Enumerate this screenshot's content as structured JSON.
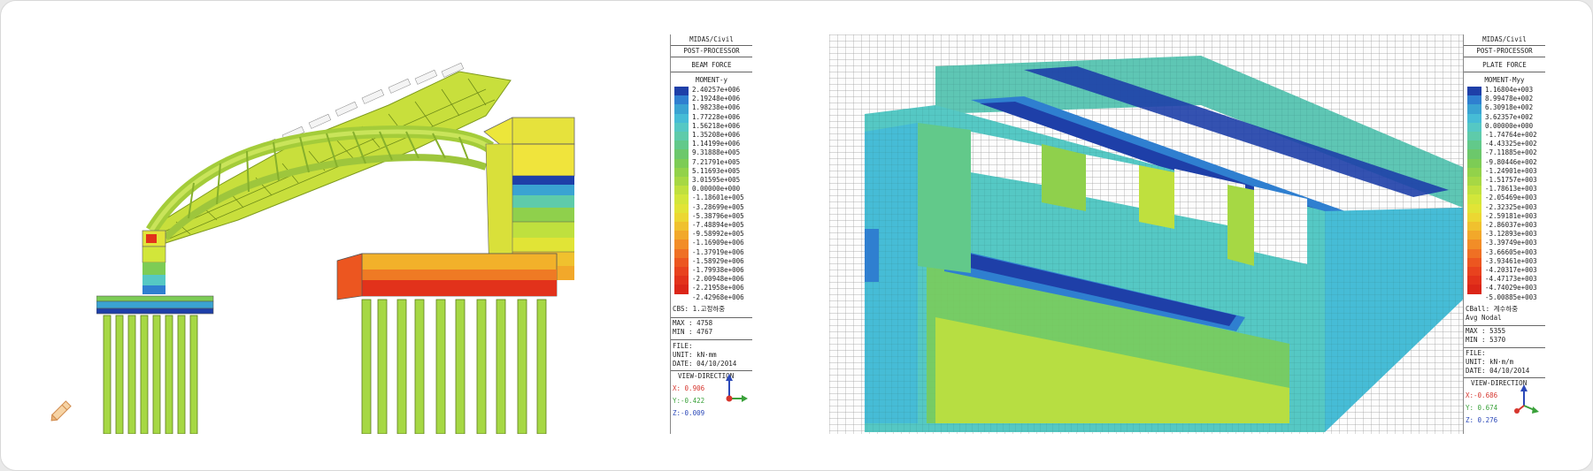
{
  "panels": [
    {
      "program": "MIDAS/Civil",
      "module": "POST-PROCESSOR",
      "force_type": "BEAM FORCE",
      "component": "MOMENT-y",
      "scale_values": [
        "2.40257e+006",
        "2.19248e+006",
        "1.98238e+006",
        "1.77228e+006",
        "1.56218e+006",
        "1.35208e+006",
        "1.14199e+006",
        "9.31888e+005",
        "7.21791e+005",
        "5.11693e+005",
        "3.01595e+005",
        "0.00000e+000",
        "-1.18601e+005",
        "-3.28699e+005",
        "-5.38796e+005",
        "-7.48894e+005",
        "-9.58992e+005",
        "-1.16909e+006",
        "-1.37919e+006",
        "-1.58929e+006",
        "-1.79938e+006",
        "-2.00948e+006",
        "-2.21958e+006",
        "-2.42968e+006"
      ],
      "load_case": "CBS: 1.고정하중",
      "max_label": "MAX : 4758",
      "min_label": "MIN : 4767",
      "file_label": "FILE:",
      "unit_label": "UNIT: kN·mm",
      "date_label": "DATE: 04/10/2014",
      "view_direction_label": "VIEW-DIRECTION",
      "view_x": "X: 0.906",
      "view_y": "Y:-0.422",
      "view_z": "Z:-0.009"
    },
    {
      "program": "MIDAS/Civil",
      "module": "POST-PROCESSOR",
      "force_type": "PLATE FORCE",
      "component": "MOMENT-Myy",
      "scale_values": [
        "1.16804e+003",
        "8.99478e+002",
        "6.30918e+002",
        "3.62357e+002",
        "0.00000e+000",
        "-1.74764e+002",
        "-4.43325e+002",
        "-7.11885e+002",
        "-9.80446e+002",
        "-1.24901e+003",
        "-1.51757e+003",
        "-1.78613e+003",
        "-2.05469e+003",
        "-2.32325e+003",
        "-2.59181e+003",
        "-2.86037e+003",
        "-3.12893e+003",
        "-3.39749e+003",
        "-3.66605e+003",
        "-3.93461e+003",
        "-4.20317e+003",
        "-4.47173e+003",
        "-4.74029e+003",
        "-5.00885e+003"
      ],
      "load_case": "CBall: 계수하중",
      "nodal_label": "Avg Nodal",
      "max_label": "MAX : 5355",
      "min_label": "MIN : 5370",
      "file_label": "FILE:",
      "unit_label": "UNIT: kN·m/m",
      "date_label": "DATE: 04/10/2014",
      "view_direction_label": "VIEW-DIRECTION",
      "view_x": "X:-0.686",
      "view_y": "Y: 0.674",
      "view_z": "Z: 0.276"
    }
  ],
  "colors": {
    "scale": [
      "#1e3fa8",
      "#2f7fd0",
      "#3aa3d2",
      "#46bcd6",
      "#55c8c4",
      "#5ecbaa",
      "#62c98a",
      "#6cc86b",
      "#7dcc55",
      "#92d24a",
      "#a6d844",
      "#bfe03e",
      "#d2e63a",
      "#e1e436",
      "#ecd732",
      "#f0c12e",
      "#f2a82a",
      "#f28d27",
      "#ef7024",
      "#ec5620",
      "#e8421e",
      "#e2321b",
      "#db2618",
      "#d21a15"
    ]
  },
  "icons": [
    "pencil-icon",
    "axis-triad-icon"
  ]
}
